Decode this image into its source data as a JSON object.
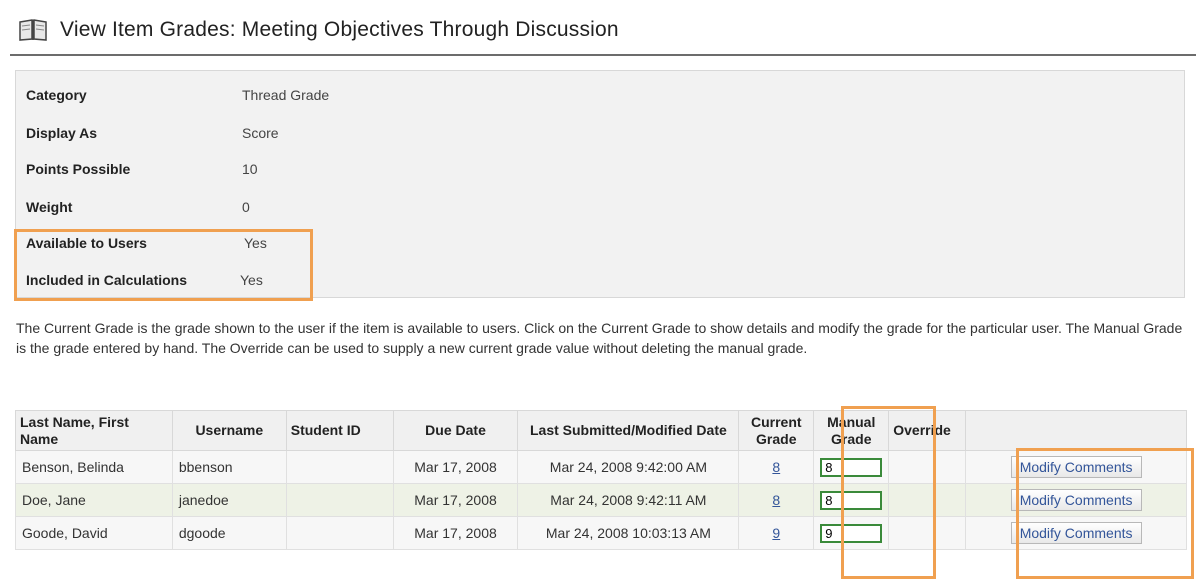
{
  "header": {
    "title": "View Item Grades: Meeting Objectives Through Discussion",
    "icon": "book-icon"
  },
  "properties": [
    {
      "label": "Category",
      "value": "Thread Grade"
    },
    {
      "label": "Display As",
      "value": "Score"
    },
    {
      "label": "Points Possible",
      "value": "10"
    },
    {
      "label": "Weight",
      "value": "0"
    },
    {
      "label": "Available to Users",
      "value": "Yes"
    },
    {
      "label": "Included in Calculations",
      "value": "Yes"
    }
  ],
  "description": "The Current Grade is the grade shown to the user if the item is available to users. Click on the Current Grade to show details and modify the grade for the particular user. The Manual Grade is the grade entered by hand. The Override can be used to supply a new current grade value without deleting the manual grade.",
  "table": {
    "columns": [
      "Last Name, First Name",
      "Username",
      "Student ID",
      "Due Date",
      "Last Submitted/Modified Date",
      "Current Grade",
      "Manual Grade",
      "Override",
      ""
    ],
    "rows": [
      {
        "name": "Benson, Belinda",
        "username": "bbenson",
        "student_id": "",
        "due_date": "Mar 17, 2008",
        "last_modified": "Mar 24, 2008 9:42:00 AM",
        "current_grade": "8",
        "manual_grade": "8",
        "override": "",
        "action": "Modify Comments"
      },
      {
        "name": "Doe, Jane",
        "username": "janedoe",
        "student_id": "",
        "due_date": "Mar 17, 2008",
        "last_modified": "Mar 24, 2008 9:42:11 AM",
        "current_grade": "8",
        "manual_grade": "8",
        "override": "",
        "action": "Modify Comments"
      },
      {
        "name": "Goode, David",
        "username": "dgoode",
        "student_id": "",
        "due_date": "Mar 17, 2008",
        "last_modified": "Mar 24, 2008 10:03:13 AM",
        "current_grade": "9",
        "manual_grade": "9",
        "override": "",
        "action": "Modify Comments"
      }
    ]
  },
  "colors": {
    "highlight": "#f0a050",
    "date_text": "#9933cc",
    "link": "#335599"
  }
}
